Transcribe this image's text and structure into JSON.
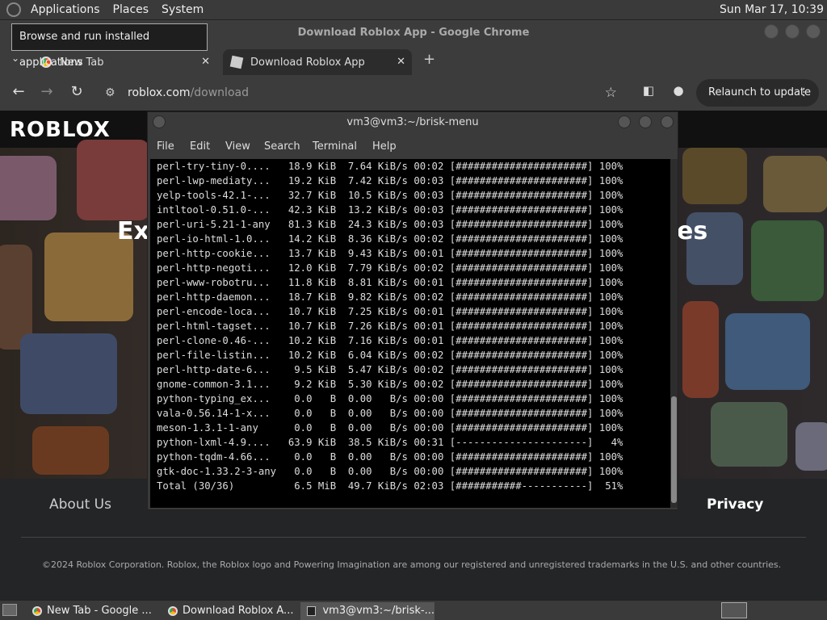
{
  "top_panel": {
    "menus": [
      "Applications",
      "Places",
      "System"
    ],
    "clock": "Sun Mar 17, 10:39"
  },
  "tooltip": "Browse and run installed applications",
  "chrome": {
    "window_title": "Download Roblox App - Google Chrome",
    "tabs": [
      {
        "label": "New Tab",
        "close": "✕"
      },
      {
        "label": "Download Roblox App",
        "close": "✕"
      }
    ],
    "new_tab": "+",
    "url_host": "roblox.com",
    "url_path": "/download",
    "relaunch_label": "Relaunch to update"
  },
  "page": {
    "logo": "ROBLOX",
    "hero_left": "Ex",
    "hero_right": "es",
    "footer_links": [
      "About Us",
      "Privacy"
    ],
    "copyright": "©2024 Roblox Corporation. Roblox, the Roblox logo and Powering Imagination are among our registered and unregistered trademarks in the U.S. and other countries."
  },
  "terminal": {
    "title": "vm3@vm3:~/brisk-menu",
    "menu": [
      "File",
      "Edit",
      "View",
      "Search",
      "Terminal",
      "Help"
    ],
    "lines": [
      "perl-try-tiny-0....   18.9 KiB  7.64 KiB/s 00:02 [######################] 100%",
      "perl-lwp-mediaty...   19.2 KiB  7.42 KiB/s 00:03 [######################] 100%",
      "yelp-tools-42.1-...   32.7 KiB  10.5 KiB/s 00:03 [######################] 100%",
      "intltool-0.51.0-...   42.3 KiB  13.2 KiB/s 00:03 [######################] 100%",
      "perl-uri-5.21-1-any   81.3 KiB  24.3 KiB/s 00:03 [######################] 100%",
      "perl-io-html-1.0...   14.2 KiB  8.36 KiB/s 00:02 [######################] 100%",
      "perl-http-cookie...   13.7 KiB  9.43 KiB/s 00:01 [######################] 100%",
      "perl-http-negoti...   12.0 KiB  7.79 KiB/s 00:02 [######################] 100%",
      "perl-www-robotru...   11.8 KiB  8.81 KiB/s 00:01 [######################] 100%",
      "perl-http-daemon...   18.7 KiB  9.82 KiB/s 00:02 [######################] 100%",
      "perl-encode-loca...   10.7 KiB  7.25 KiB/s 00:01 [######################] 100%",
      "perl-html-tagset...   10.7 KiB  7.26 KiB/s 00:01 [######################] 100%",
      "perl-clone-0.46-...   10.2 KiB  7.16 KiB/s 00:01 [######################] 100%",
      "perl-file-listin...   10.2 KiB  6.04 KiB/s 00:02 [######################] 100%",
      "perl-http-date-6...    9.5 KiB  5.47 KiB/s 00:02 [######################] 100%",
      "gnome-common-3.1...    9.2 KiB  5.30 KiB/s 00:02 [######################] 100%",
      "python-typing_ex...    0.0   B  0.00   B/s 00:00 [######################] 100%",
      "vala-0.56.14-1-x...    0.0   B  0.00   B/s 00:00 [######################] 100%",
      "meson-1.3.1-1-any      0.0   B  0.00   B/s 00:00 [######################] 100%",
      "python-lxml-4.9....   63.9 KiB  38.5 KiB/s 00:31 [----------------------]   4%",
      "python-tqdm-4.66...    0.0   B  0.00   B/s 00:00 [######################] 100%",
      "gtk-doc-1.33.2-3-any   0.0   B  0.00   B/s 00:00 [######################] 100%",
      "Total (30/36)          6.5 MiB  49.7 KiB/s 02:03 [###########-----------]  51%"
    ]
  },
  "taskbar": {
    "items": [
      "New Tab - Google ...",
      "Download Roblox A...",
      "vm3@vm3:~/brisk-..."
    ]
  }
}
